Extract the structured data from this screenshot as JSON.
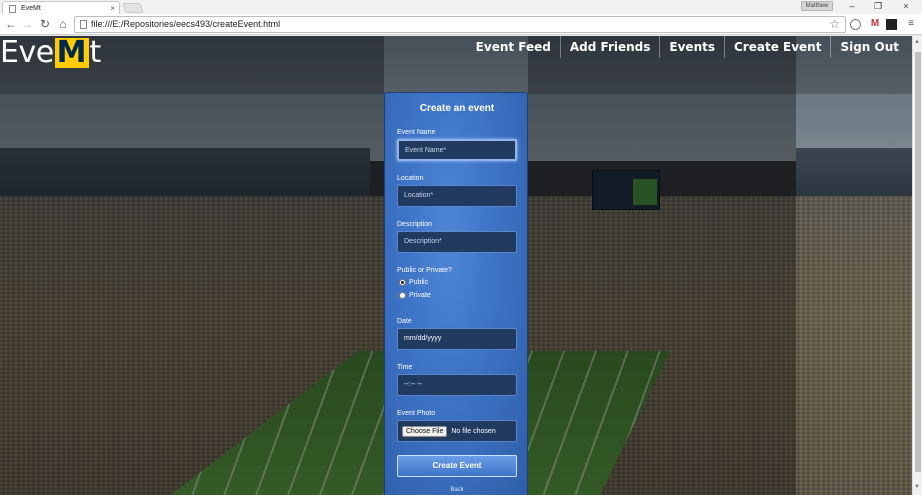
{
  "browser": {
    "tab_title": "EveMt",
    "tab_close": "×",
    "user_chip": "Matthew",
    "url": "file:///E:/Repositories/eecs493/createEvent.html",
    "window_controls": [
      "–",
      "❐",
      "×"
    ],
    "nav_back": "←",
    "nav_forward": "→",
    "nav_reload": "↻",
    "nav_home": "⌂",
    "star": "☆"
  },
  "site": {
    "logo_prefix": "Eve",
    "logo_m": "M",
    "logo_suffix": "t",
    "nav": [
      "Event Feed",
      "Add Friends",
      "Events",
      "Create Event",
      "Sign Out"
    ]
  },
  "form": {
    "title": "Create an event",
    "event_name_label": "Event Name",
    "event_name_placeholder": "Event Name*",
    "location_label": "Location",
    "location_placeholder": "Location*",
    "description_label": "Description",
    "description_placeholder": "Description*",
    "visibility_label": "Public or Private?",
    "visibility_options": [
      {
        "label": "Public",
        "checked": true
      },
      {
        "label": "Private",
        "checked": false
      }
    ],
    "date_label": "Date",
    "date_value": "mm/dd/yyyy",
    "time_label": "Time",
    "time_value": "--:-- --",
    "photo_label": "Event Photo",
    "file_button": "Choose File",
    "file_status": "No file chosen",
    "submit_label": "Create Event",
    "back_label": "Back"
  },
  "colors": {
    "panel_blue": "#3e74c7",
    "maize": "#ffcb05",
    "michigan_blue": "#00274c"
  }
}
